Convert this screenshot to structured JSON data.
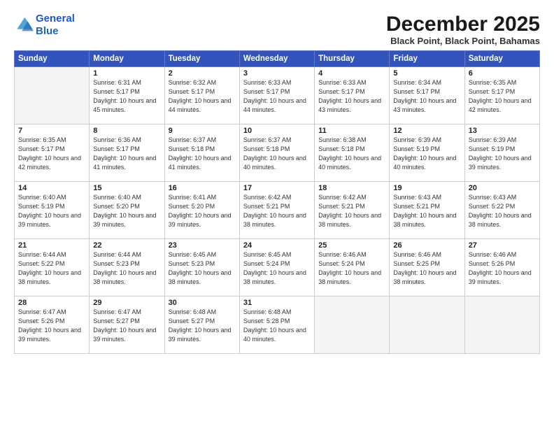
{
  "header": {
    "logo_line1": "General",
    "logo_line2": "Blue",
    "month_title": "December 2025",
    "location": "Black Point, Black Point, Bahamas"
  },
  "weekdays": [
    "Sunday",
    "Monday",
    "Tuesday",
    "Wednesday",
    "Thursday",
    "Friday",
    "Saturday"
  ],
  "weeks": [
    [
      {
        "day": "",
        "sunrise": "",
        "sunset": "",
        "daylight": ""
      },
      {
        "day": "1",
        "sunrise": "Sunrise: 6:31 AM",
        "sunset": "Sunset: 5:17 PM",
        "daylight": "Daylight: 10 hours and 45 minutes."
      },
      {
        "day": "2",
        "sunrise": "Sunrise: 6:32 AM",
        "sunset": "Sunset: 5:17 PM",
        "daylight": "Daylight: 10 hours and 44 minutes."
      },
      {
        "day": "3",
        "sunrise": "Sunrise: 6:33 AM",
        "sunset": "Sunset: 5:17 PM",
        "daylight": "Daylight: 10 hours and 44 minutes."
      },
      {
        "day": "4",
        "sunrise": "Sunrise: 6:33 AM",
        "sunset": "Sunset: 5:17 PM",
        "daylight": "Daylight: 10 hours and 43 minutes."
      },
      {
        "day": "5",
        "sunrise": "Sunrise: 6:34 AM",
        "sunset": "Sunset: 5:17 PM",
        "daylight": "Daylight: 10 hours and 43 minutes."
      },
      {
        "day": "6",
        "sunrise": "Sunrise: 6:35 AM",
        "sunset": "Sunset: 5:17 PM",
        "daylight": "Daylight: 10 hours and 42 minutes."
      }
    ],
    [
      {
        "day": "7",
        "sunrise": "Sunrise: 6:35 AM",
        "sunset": "Sunset: 5:17 PM",
        "daylight": "Daylight: 10 hours and 42 minutes."
      },
      {
        "day": "8",
        "sunrise": "Sunrise: 6:36 AM",
        "sunset": "Sunset: 5:17 PM",
        "daylight": "Daylight: 10 hours and 41 minutes."
      },
      {
        "day": "9",
        "sunrise": "Sunrise: 6:37 AM",
        "sunset": "Sunset: 5:18 PM",
        "daylight": "Daylight: 10 hours and 41 minutes."
      },
      {
        "day": "10",
        "sunrise": "Sunrise: 6:37 AM",
        "sunset": "Sunset: 5:18 PM",
        "daylight": "Daylight: 10 hours and 40 minutes."
      },
      {
        "day": "11",
        "sunrise": "Sunrise: 6:38 AM",
        "sunset": "Sunset: 5:18 PM",
        "daylight": "Daylight: 10 hours and 40 minutes."
      },
      {
        "day": "12",
        "sunrise": "Sunrise: 6:39 AM",
        "sunset": "Sunset: 5:19 PM",
        "daylight": "Daylight: 10 hours and 40 minutes."
      },
      {
        "day": "13",
        "sunrise": "Sunrise: 6:39 AM",
        "sunset": "Sunset: 5:19 PM",
        "daylight": "Daylight: 10 hours and 39 minutes."
      }
    ],
    [
      {
        "day": "14",
        "sunrise": "Sunrise: 6:40 AM",
        "sunset": "Sunset: 5:19 PM",
        "daylight": "Daylight: 10 hours and 39 minutes."
      },
      {
        "day": "15",
        "sunrise": "Sunrise: 6:40 AM",
        "sunset": "Sunset: 5:20 PM",
        "daylight": "Daylight: 10 hours and 39 minutes."
      },
      {
        "day": "16",
        "sunrise": "Sunrise: 6:41 AM",
        "sunset": "Sunset: 5:20 PM",
        "daylight": "Daylight: 10 hours and 39 minutes."
      },
      {
        "day": "17",
        "sunrise": "Sunrise: 6:42 AM",
        "sunset": "Sunset: 5:21 PM",
        "daylight": "Daylight: 10 hours and 38 minutes."
      },
      {
        "day": "18",
        "sunrise": "Sunrise: 6:42 AM",
        "sunset": "Sunset: 5:21 PM",
        "daylight": "Daylight: 10 hours and 38 minutes."
      },
      {
        "day": "19",
        "sunrise": "Sunrise: 6:43 AM",
        "sunset": "Sunset: 5:21 PM",
        "daylight": "Daylight: 10 hours and 38 minutes."
      },
      {
        "day": "20",
        "sunrise": "Sunrise: 6:43 AM",
        "sunset": "Sunset: 5:22 PM",
        "daylight": "Daylight: 10 hours and 38 minutes."
      }
    ],
    [
      {
        "day": "21",
        "sunrise": "Sunrise: 6:44 AM",
        "sunset": "Sunset: 5:22 PM",
        "daylight": "Daylight: 10 hours and 38 minutes."
      },
      {
        "day": "22",
        "sunrise": "Sunrise: 6:44 AM",
        "sunset": "Sunset: 5:23 PM",
        "daylight": "Daylight: 10 hours and 38 minutes."
      },
      {
        "day": "23",
        "sunrise": "Sunrise: 6:45 AM",
        "sunset": "Sunset: 5:23 PM",
        "daylight": "Daylight: 10 hours and 38 minutes."
      },
      {
        "day": "24",
        "sunrise": "Sunrise: 6:45 AM",
        "sunset": "Sunset: 5:24 PM",
        "daylight": "Daylight: 10 hours and 38 minutes."
      },
      {
        "day": "25",
        "sunrise": "Sunrise: 6:46 AM",
        "sunset": "Sunset: 5:24 PM",
        "daylight": "Daylight: 10 hours and 38 minutes."
      },
      {
        "day": "26",
        "sunrise": "Sunrise: 6:46 AM",
        "sunset": "Sunset: 5:25 PM",
        "daylight": "Daylight: 10 hours and 38 minutes."
      },
      {
        "day": "27",
        "sunrise": "Sunrise: 6:46 AM",
        "sunset": "Sunset: 5:26 PM",
        "daylight": "Daylight: 10 hours and 39 minutes."
      }
    ],
    [
      {
        "day": "28",
        "sunrise": "Sunrise: 6:47 AM",
        "sunset": "Sunset: 5:26 PM",
        "daylight": "Daylight: 10 hours and 39 minutes."
      },
      {
        "day": "29",
        "sunrise": "Sunrise: 6:47 AM",
        "sunset": "Sunset: 5:27 PM",
        "daylight": "Daylight: 10 hours and 39 minutes."
      },
      {
        "day": "30",
        "sunrise": "Sunrise: 6:48 AM",
        "sunset": "Sunset: 5:27 PM",
        "daylight": "Daylight: 10 hours and 39 minutes."
      },
      {
        "day": "31",
        "sunrise": "Sunrise: 6:48 AM",
        "sunset": "Sunset: 5:28 PM",
        "daylight": "Daylight: 10 hours and 40 minutes."
      },
      {
        "day": "",
        "sunrise": "",
        "sunset": "",
        "daylight": ""
      },
      {
        "day": "",
        "sunrise": "",
        "sunset": "",
        "daylight": ""
      },
      {
        "day": "",
        "sunrise": "",
        "sunset": "",
        "daylight": ""
      }
    ]
  ]
}
